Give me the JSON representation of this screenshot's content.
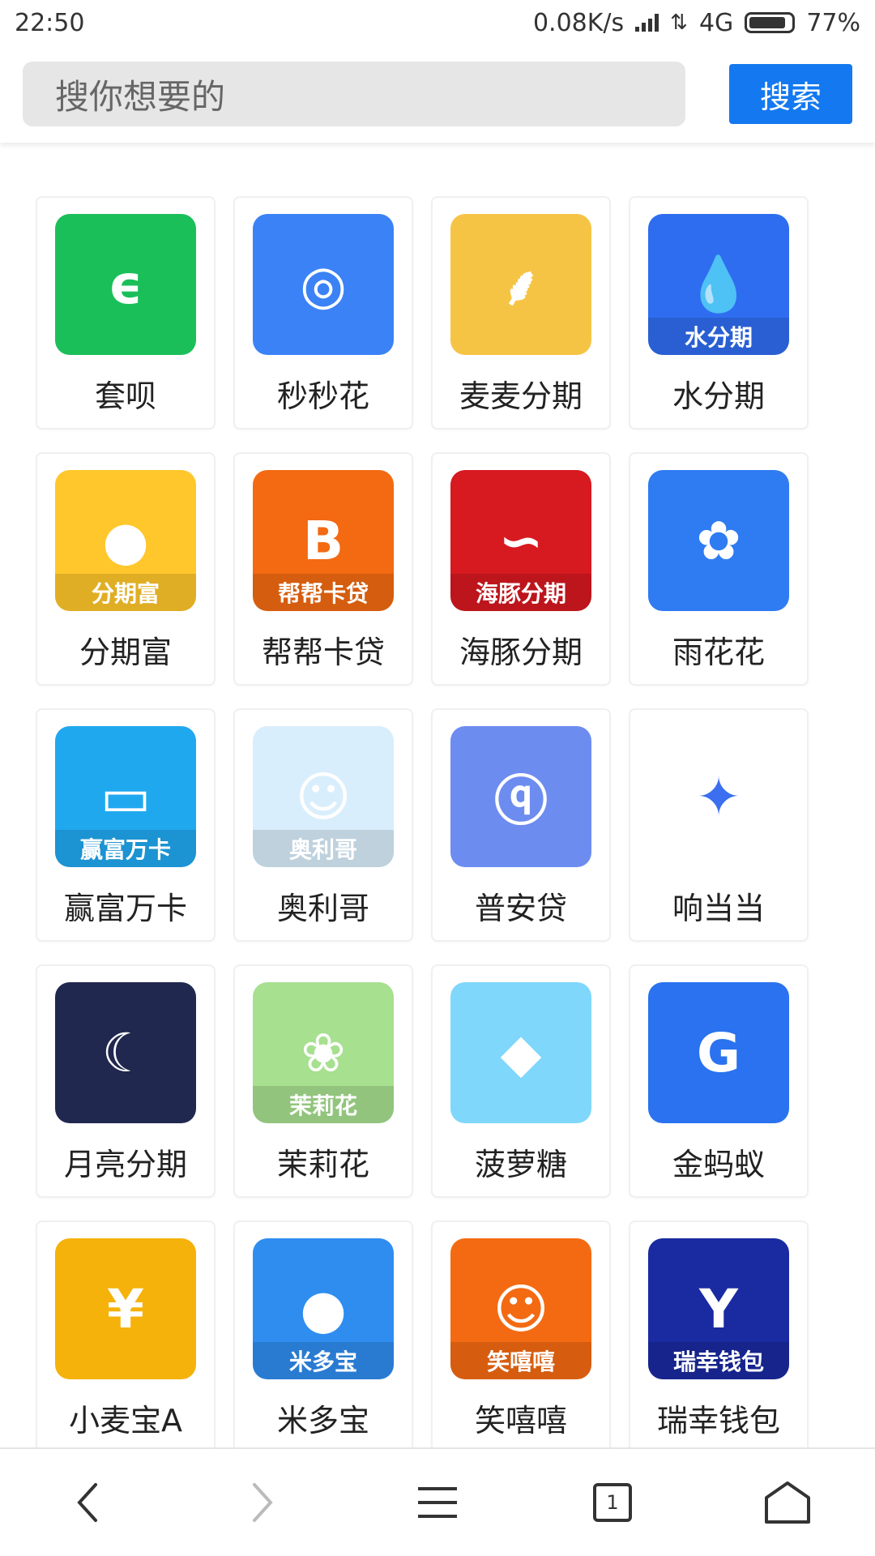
{
  "status_bar": {
    "time": "22:50",
    "speed": "0.08K/s",
    "network": "4G",
    "battery": "77%"
  },
  "search": {
    "placeholder": "搜你想要的",
    "button_label": "搜索"
  },
  "apps": [
    {
      "name": "套呗",
      "icon": "taobei-logo",
      "color": "#1bbf5a",
      "band": ""
    },
    {
      "name": "秒秒花",
      "icon": "stopwatch-coin-logo",
      "color": "#3b82f6",
      "band": ""
    },
    {
      "name": "麦麦分期",
      "icon": "wheat-logo",
      "color": "#f6c445",
      "band": ""
    },
    {
      "name": "水分期",
      "icon": "water-drop-logo",
      "color": "#2f6df0",
      "band": "水分期"
    },
    {
      "name": "分期富",
      "icon": "chick-logo",
      "color": "#ffc72b",
      "band": "分期富"
    },
    {
      "name": "帮帮卡贷",
      "icon": "card-b-logo",
      "color": "#f36a12",
      "band": "帮帮卡贷"
    },
    {
      "name": "海豚分期",
      "icon": "dolphin-logo",
      "color": "#d71920",
      "band": "海豚分期"
    },
    {
      "name": "雨花花",
      "icon": "lotus-hand-logo",
      "color": "#2f7bf2",
      "band": ""
    },
    {
      "name": "赢富万卡",
      "icon": "wallet-card-logo",
      "color": "#20a8ef",
      "band": "赢富万卡"
    },
    {
      "name": "奥利哥",
      "icon": "man-portrait-logo",
      "color": "#d9eefc",
      "band": "奥利哥"
    },
    {
      "name": "普安贷",
      "icon": "figure-logo",
      "color": "#6d8cf0",
      "band": ""
    },
    {
      "name": "响当当",
      "icon": "dc-star-logo",
      "color": "#ffffff",
      "band": ""
    },
    {
      "name": "月亮分期",
      "icon": "moon-cloud-logo",
      "color": "#20284f",
      "band": ""
    },
    {
      "name": "茉莉花",
      "icon": "jasmine-logo",
      "color": "#a7e08f",
      "band": "茉莉花"
    },
    {
      "name": "菠萝糖",
      "icon": "pineapple-logo",
      "color": "#7fd7fb",
      "band": ""
    },
    {
      "name": "金蚂蚁",
      "icon": "ant-logo",
      "color": "#2a72ef",
      "band": ""
    },
    {
      "name": "小麦宝A",
      "icon": "yen-wreath-logo",
      "color": "#f5b20a",
      "band": ""
    },
    {
      "name": "米多宝",
      "icon": "pig-god-logo",
      "color": "#2f8df0",
      "band": "米多宝"
    },
    {
      "name": "笑嘻嘻",
      "icon": "fortune-god-logo",
      "color": "#f46a12",
      "band": "笑嘻嘻"
    },
    {
      "name": "瑞幸钱包",
      "icon": "deer-coin-logo",
      "color": "#1a2aa0",
      "band": "瑞幸钱包"
    }
  ],
  "bottom_nav": {
    "back": "back-icon",
    "forward": "forward-icon",
    "menu": "menu-icon",
    "tabs_count": "1",
    "home": "home-icon"
  }
}
